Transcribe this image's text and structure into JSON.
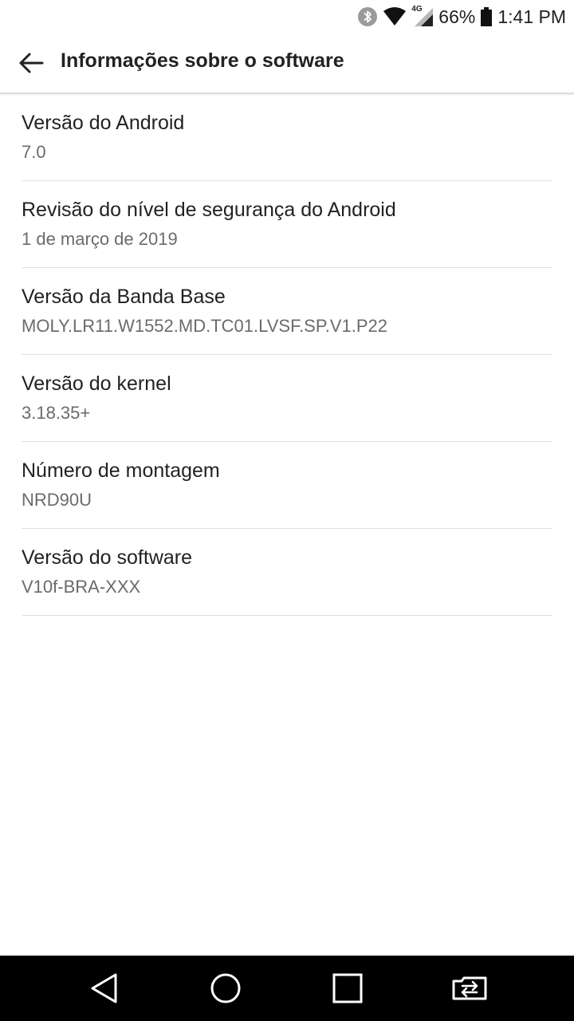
{
  "status_bar": {
    "network_type": "4G",
    "battery_percent": "66%",
    "time": "1:41 PM",
    "icons": [
      "bluetooth-icon",
      "wifi-icon",
      "signal-icon",
      "battery-icon"
    ]
  },
  "header": {
    "title": "Informações sobre o software",
    "back_icon": "back-arrow-icon"
  },
  "items": [
    {
      "title": "Versão do Android",
      "value": "7.0"
    },
    {
      "title": "Revisão do nível de segurança do Android",
      "value": "1 de março de 2019"
    },
    {
      "title": "Versão da Banda Base",
      "value": "MOLY.LR11.W1552.MD.TC01.LVSF.SP.V1.P22"
    },
    {
      "title": "Versão do kernel",
      "value": "3.18.35+"
    },
    {
      "title": "Número de montagem",
      "value": "NRD90U"
    },
    {
      "title": "Versão do software",
      "value": "V10f-BRA-XXX"
    }
  ],
  "nav_bar": {
    "buttons": [
      "back-triangle-icon",
      "home-circle-icon",
      "recents-square-icon",
      "dual-window-icon"
    ]
  }
}
